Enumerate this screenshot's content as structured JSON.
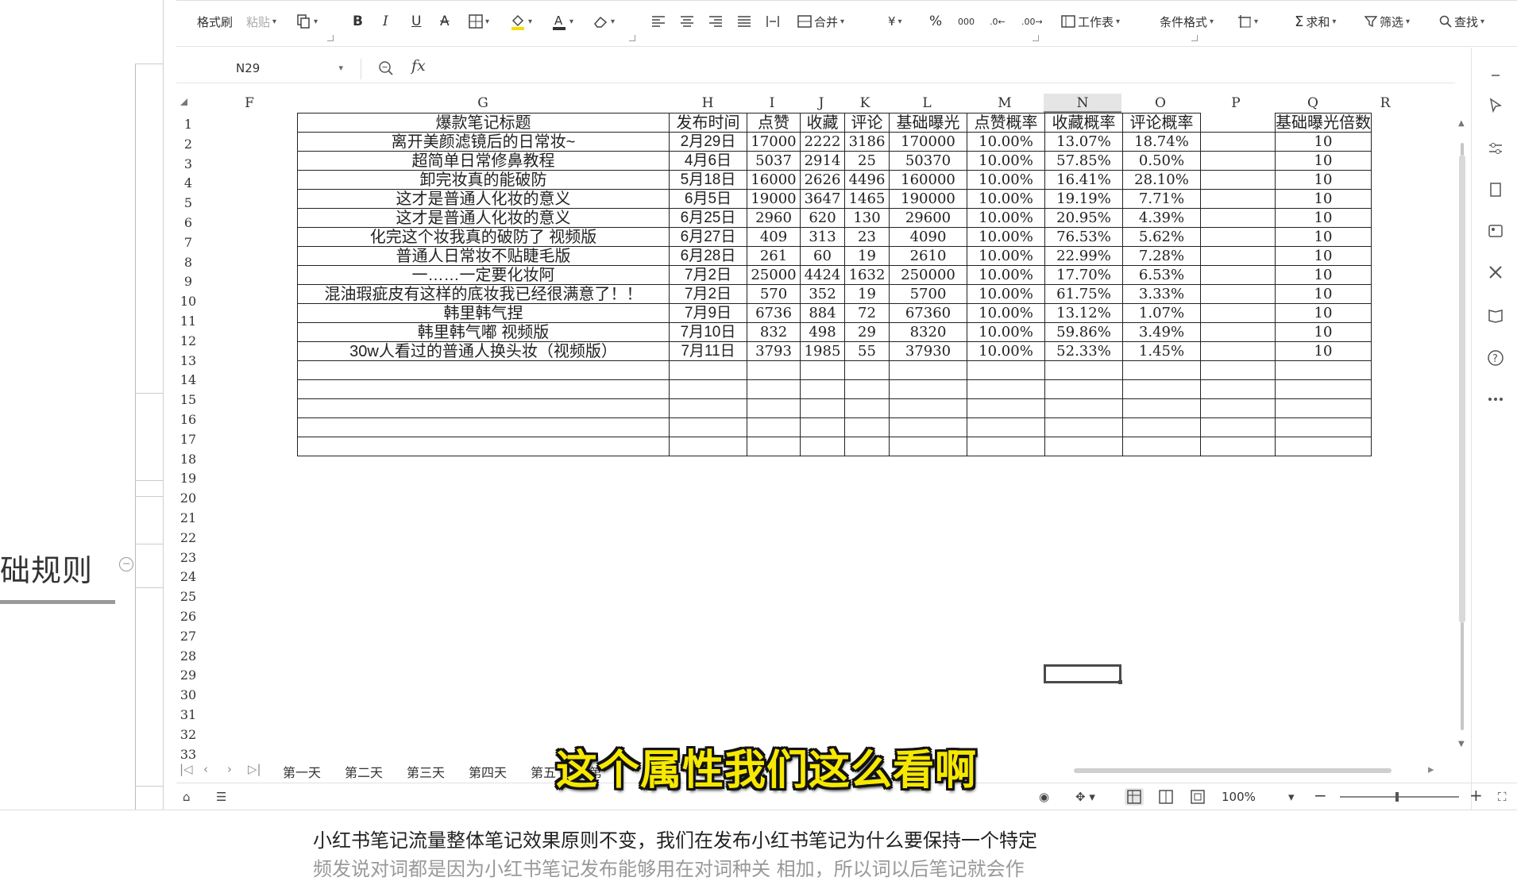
{
  "left_doc": {
    "heading": "础规则"
  },
  "ribbon": {
    "items": [
      {
        "label": "格式刷"
      },
      {
        "label": "粘贴"
      },
      {
        "label": "B"
      },
      {
        "label": "I"
      },
      {
        "label": "U"
      },
      {
        "label": "合并"
      },
      {
        "label": "¥"
      },
      {
        "label": "%"
      },
      {
        "label": "工作表"
      },
      {
        "label": "条件格式"
      },
      {
        "label": "求和"
      },
      {
        "label": "筛选"
      },
      {
        "label": "查找"
      }
    ]
  },
  "formula_bar": {
    "name_box": "N29",
    "fx_label": "fx"
  },
  "columns": [
    "F",
    "G",
    "H",
    "I",
    "J",
    "K",
    "L",
    "M",
    "N",
    "O",
    "P",
    "Q",
    "R"
  ],
  "selected_column": "N",
  "rows": [
    "1",
    "2",
    "3",
    "4",
    "5",
    "6",
    "7",
    "8",
    "9",
    "10",
    "11",
    "12",
    "13",
    "14",
    "15",
    "16",
    "17",
    "18",
    "19",
    "20",
    "21",
    "22",
    "23",
    "24",
    "25",
    "26",
    "27",
    "28",
    "29",
    "30",
    "31",
    "32",
    "33"
  ],
  "table": {
    "headers": [
      "爆款笔记标题",
      "发布时间",
      "点赞",
      "收藏",
      "评论",
      "基础曝光",
      "点赞概率",
      "收藏概率",
      "评论概率",
      "",
      "基础曝光倍数"
    ],
    "rows": [
      [
        "离开美颜滤镜后的日常妆~",
        "2月29日",
        "17000",
        "2222",
        "3186",
        "170000",
        "10.00%",
        "13.07%",
        "18.74%",
        "",
        "10"
      ],
      [
        "超简单日常修鼻教程",
        "4月6日",
        "5037",
        "2914",
        "25",
        "50370",
        "10.00%",
        "57.85%",
        "0.50%",
        "",
        "10"
      ],
      [
        "卸完妆真的能破防",
        "5月18日",
        "16000",
        "2626",
        "4496",
        "160000",
        "10.00%",
        "16.41%",
        "28.10%",
        "",
        "10"
      ],
      [
        "这才是普通人化妆的意义",
        "6月5日",
        "19000",
        "3647",
        "1465",
        "190000",
        "10.00%",
        "19.19%",
        "7.71%",
        "",
        "10"
      ],
      [
        "这才是普通人化妆的意义",
        "6月25日",
        "2960",
        "620",
        "130",
        "29600",
        "10.00%",
        "20.95%",
        "4.39%",
        "",
        "10"
      ],
      [
        "化完这个妆我真的破防了 视频版",
        "6月27日",
        "409",
        "313",
        "23",
        "4090",
        "10.00%",
        "76.53%",
        "5.62%",
        "",
        "10"
      ],
      [
        "普通人日常妆不贴睫毛版",
        "6月28日",
        "261",
        "60",
        "19",
        "2610",
        "10.00%",
        "22.99%",
        "7.28%",
        "",
        "10"
      ],
      [
        "一……一定要化妆阿",
        "7月2日",
        "25000",
        "4424",
        "1632",
        "250000",
        "10.00%",
        "17.70%",
        "6.53%",
        "",
        "10"
      ],
      [
        "混油瑕疵皮有这样的底妆我已经很满意了！！",
        "7月2日",
        "570",
        "352",
        "19",
        "5700",
        "10.00%",
        "61.75%",
        "3.33%",
        "",
        "10"
      ],
      [
        "韩里韩气捏",
        "7月9日",
        "6736",
        "884",
        "72",
        "67360",
        "10.00%",
        "13.12%",
        "1.07%",
        "",
        "10"
      ],
      [
        "韩里韩气嘟 视频版",
        "7月10日",
        "832",
        "498",
        "29",
        "8320",
        "10.00%",
        "59.86%",
        "3.49%",
        "",
        "10"
      ],
      [
        "30w人看过的普通人换头妆（视频版）",
        "7月11日",
        "3793",
        "1985",
        "55",
        "37930",
        "10.00%",
        "52.33%",
        "1.45%",
        "",
        "10"
      ]
    ],
    "empty_rows": 5
  },
  "sheet_tabs": [
    "第一天",
    "第二天",
    "第三天",
    "第四天",
    "第五",
    "第"
  ],
  "status": {
    "zoom": "100%"
  },
  "subtitle": "这个属性我们这么看啊",
  "bottom_doc": {
    "line1": "小红书笔记流量整体笔记效果原则不变，我们在发布小红书笔记为什么要保持一个特定",
    "line2": "频发说对词都是因为小红书笔记发布能够用在对词种关   相加，所以词以后笔记就会作"
  }
}
